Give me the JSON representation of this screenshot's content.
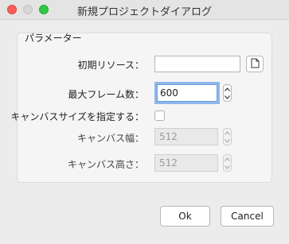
{
  "window": {
    "title": "新規プロジェクトダイアログ"
  },
  "group": {
    "label": "パラメーター"
  },
  "initial_resource": {
    "label": "初期リソース：",
    "value": "",
    "browse_icon": "document-icon"
  },
  "max_frames": {
    "label": "最大フレーム数：",
    "value": "600"
  },
  "canvas_size_toggle": {
    "label": "キャンバスサイズを指定する：",
    "checked": false
  },
  "canvas_width": {
    "label": "キャンバス幅：",
    "value": "512"
  },
  "canvas_height": {
    "label": "キャンバス高さ：",
    "value": "512"
  },
  "buttons": {
    "ok": "Ok",
    "cancel": "Cancel"
  }
}
